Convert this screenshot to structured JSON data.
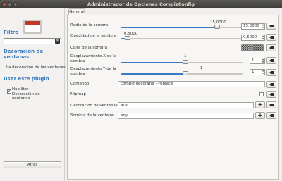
{
  "window": {
    "title": "Administrador de Opciones CompizConfig"
  },
  "sidebar": {
    "filter_heading": "Filtro",
    "filter_value": "",
    "category_heading_1": "Decoración de",
    "category_heading_2": "ventanas",
    "category_item": "La decoración de las ventanas",
    "use_heading": "Usar este plugin",
    "enable_label_1": "Habilitar",
    "enable_label_2": "Decoración de",
    "enable_label_3": "ventanas",
    "enable_checked": "✔",
    "back_button": "Atrás"
  },
  "tabs": {
    "general": "General"
  },
  "options": {
    "shadow_radius": {
      "label": "Radio de la sombra",
      "value": "15,0000",
      "slider_label": "15,0000",
      "fraction": 0.79
    },
    "shadow_opacity": {
      "label": "Opacidad de la sombra",
      "value": "0,5000",
      "slider_label": "0,5000",
      "fraction": 0.05
    },
    "shadow_color": {
      "label": "Color de la sombra"
    },
    "shadow_x": {
      "label_1": "Desplazamiento X de la",
      "label_2": "sombra",
      "value": "1",
      "slider_label": "1",
      "fraction": 0.53
    },
    "shadow_y": {
      "label_1": "Desplazamiento Y de la",
      "label_2": "sombra",
      "value": "1",
      "slider_label": "1",
      "fraction": 0.53
    },
    "command": {
      "label": "Comando",
      "value": "compiz-decorator --replace"
    },
    "mipmap": {
      "label": "Mipmap"
    },
    "decoration_windows": {
      "label": "Decoracion de ventanas",
      "value": "any"
    },
    "window_shadow": {
      "label": "Sombra de la ventana",
      "value": "any"
    }
  },
  "icons": {
    "reset": "reset-icon",
    "plus": "+"
  },
  "colors": {
    "accent": "#3a7bbf",
    "titlebar": "#3c3b37"
  }
}
